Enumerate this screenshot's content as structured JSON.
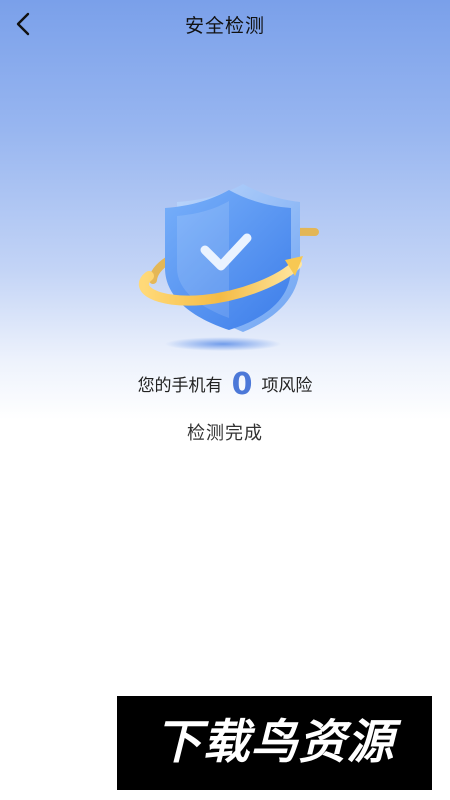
{
  "header": {
    "title": "安全检测",
    "back_icon": "chevron-left-icon"
  },
  "illustration": {
    "icon": "shield-check-icon"
  },
  "result": {
    "prefix": "您的手机有",
    "count": "0",
    "suffix": "项风险",
    "status": "检测完成"
  },
  "watermark": {
    "text": "下载鸟资源"
  },
  "colors": {
    "header_gradient_top": "#7aa0ea",
    "accent_blue": "#4c78d8",
    "shield_blue": "#5b95f2",
    "ring_gold": "#f5c24a"
  }
}
